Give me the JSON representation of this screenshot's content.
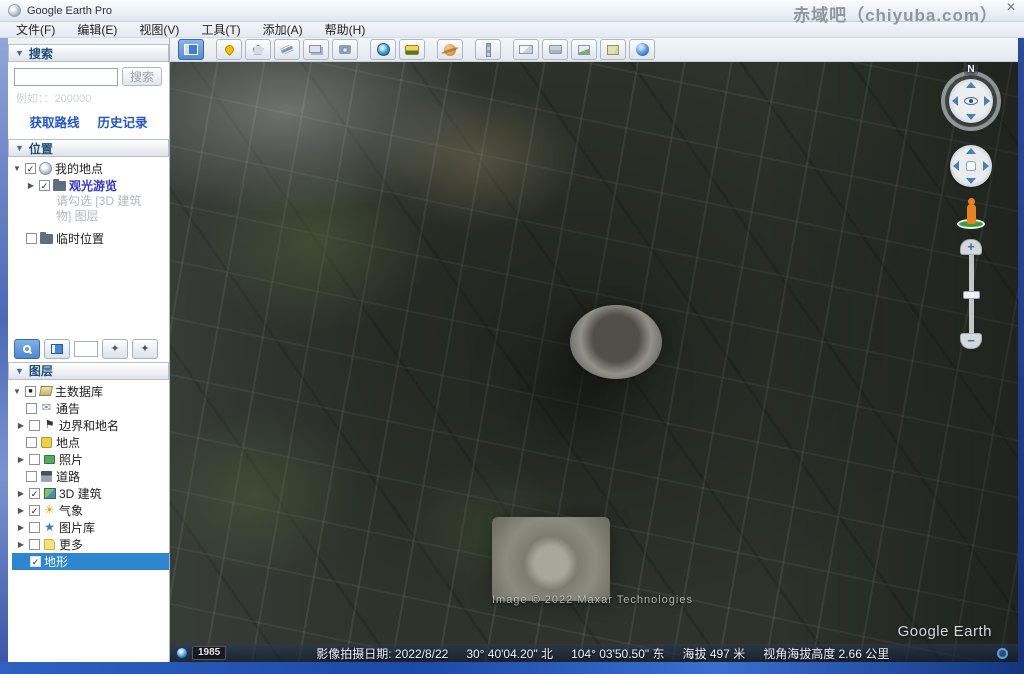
{
  "window": {
    "title": "Google Earth Pro",
    "watermark": "赤域吧（chiyuba.com）",
    "close_label": "✕"
  },
  "menu": {
    "items": [
      {
        "label": "文件(F)"
      },
      {
        "label": "编辑(E)"
      },
      {
        "label": "视图(V)"
      },
      {
        "label": "工具(T)"
      },
      {
        "label": "添加(A)"
      },
      {
        "label": "帮助(H)"
      }
    ]
  },
  "toolbar": {
    "icons": [
      "hide-sidebar",
      "add-placemark",
      "add-polygon",
      "add-path",
      "add-image-overlay",
      "record-tour",
      "historical-imagery",
      "sunlight",
      "planets",
      "ruler",
      "email",
      "print",
      "save-image",
      "view-in-google-maps",
      "globe"
    ]
  },
  "search": {
    "header": "搜索",
    "input_value": "",
    "button_label": "搜索",
    "hint": "例如：：200000",
    "links": [
      {
        "label": "获取路线"
      },
      {
        "label": "历史记录"
      }
    ]
  },
  "places": {
    "header": "位置",
    "items": [
      {
        "arrow": "▼",
        "check": "✓",
        "label": "我的地点"
      },
      {
        "arrow": "▶",
        "check": "✓",
        "label": "观光游览"
      },
      {
        "arrow": "",
        "check": "",
        "label": "临时位置"
      }
    ],
    "note_line1": "请勾选 [3D 建筑",
    "note_line2": "物] 图层"
  },
  "layers": {
    "header": "图层",
    "items": [
      {
        "arrow": "▼",
        "check": "■",
        "label": "主数据库"
      },
      {
        "arrow": "",
        "check": "",
        "label": "通告"
      },
      {
        "arrow": "▶",
        "check": "",
        "label": "边界和地名"
      },
      {
        "arrow": "",
        "check": "",
        "label": "地点"
      },
      {
        "arrow": "▶",
        "check": "",
        "label": "照片"
      },
      {
        "arrow": "",
        "check": "",
        "label": "道路"
      },
      {
        "arrow": "▶",
        "check": "✓",
        "label": "3D 建筑"
      },
      {
        "arrow": "▶",
        "check": "✓",
        "label": "气象"
      },
      {
        "arrow": "▶",
        "check": "",
        "label": "图片库"
      },
      {
        "arrow": "▶",
        "check": "",
        "label": "更多"
      },
      {
        "arrow": "",
        "check": "✓",
        "label": "地形"
      }
    ],
    "icon_glyphs": {
      "envelope": "✉",
      "flag": "⚑",
      "sun": "☀",
      "star": "★"
    }
  },
  "nav": {
    "north_label": "N",
    "zoom_in_label": "+",
    "zoom_out_label": "−"
  },
  "map": {
    "attribution": "Image © 2022 Maxar Technologies",
    "logo": "Google Earth"
  },
  "statusbar": {
    "year_badge": "1985",
    "imagery_date": "影像拍摄日期: 2022/8/22",
    "latitude": "30° 40'04.20\" 北",
    "longitude": "104° 03'50.50\" 东",
    "elevation": "海拔   497 米",
    "eye_altitude": "视角海拔高度   2.66 公里"
  },
  "colors": {
    "accent_blue": "#2e86d0",
    "link_blue": "#2255cc",
    "frame_blue": "#2b5fb0",
    "pegman_orange": "#e8821e"
  }
}
